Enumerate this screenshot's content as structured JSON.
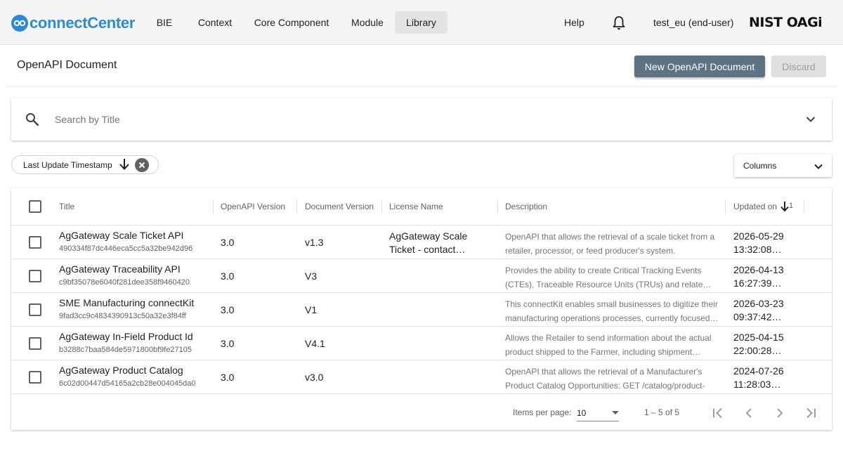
{
  "app": {
    "logo_text": "connectCenter",
    "nav": [
      "BIE",
      "Context",
      "Core Component",
      "Module",
      "Library"
    ],
    "help": "Help",
    "user": "test_eu (end-user)",
    "brand": "NIST OAGi"
  },
  "header": {
    "title": "OpenAPI Document",
    "new_button": "New OpenAPI Document",
    "discard_button": "Discard"
  },
  "search": {
    "placeholder": "Search by Title"
  },
  "sort_chip": {
    "label": "Last Update Timestamp"
  },
  "columns_button": "Columns",
  "table": {
    "headers": {
      "title": "Title",
      "openapi_version": "OpenAPI Version",
      "document_version": "Document Version",
      "license_name": "License Name",
      "description": "Description",
      "updated_on": "Updated on",
      "sort_index": "1"
    },
    "rows": [
      {
        "title": "AgGateway Scale Ticket API",
        "guid": "490334f87dc446eca5cc5a32be942d96",
        "openapi_version": "3.0",
        "document_version": "v1.3",
        "license_name": "AgGateway Scale Ticket - contact…",
        "description": "OpenAPI that allows the retrieval of a scale ticket from a retailer, processor, or feed producer's system.",
        "date": "2026-05-29",
        "time": "13:32:08…"
      },
      {
        "title": "AgGateway Traceability API",
        "guid": "c9bf35078e6040f281dee358f9460420",
        "openapi_version": "3.0",
        "document_version": "V3",
        "license_name": "",
        "description": "Provides the ability to create Critical Tracking Events (CTEs), Traceable Resource Units (TRUs) and relate…",
        "date": "2026-04-13",
        "time": "16:27:39…"
      },
      {
        "title": "SME Manufacturing connectKit",
        "guid": "9fad3cc9c4834390913c50a32e3f84ff",
        "openapi_version": "3.0",
        "document_version": "V1",
        "license_name": "",
        "description": "This connectKit enables small businesses to digitize their manufacturing operations processes, currently focused…",
        "date": "2026-03-23",
        "time": "09:37:42…"
      },
      {
        "title": "AgGateway In-Field Product Id",
        "guid": "b3288c7baa584de5971800bf9fe27105",
        "openapi_version": "3.0",
        "document_version": "V4.1",
        "license_name": "",
        "description": "Allows the Retailer to send information about the actual product shipped to the Farmer, including shipment…",
        "date": "2025-04-15",
        "time": "22:00:28…"
      },
      {
        "title": "AgGateway Product Catalog",
        "guid": "6c02d00447d54165a2cb28e004045da0",
        "openapi_version": "3.0",
        "document_version": "v3.0",
        "license_name": "",
        "description": "OpenAPI that allows the retrieval of a Manufacturer's Product Catalog Opportunities: GET /catalog/product-lis…",
        "date": "2024-07-26",
        "time": "11:28:03…"
      }
    ]
  },
  "paginator": {
    "items_per_page_label": "Items per page:",
    "items_per_page": "10",
    "range": "1 – 5 of 5"
  },
  "colors": {
    "brand_blue": "#2b8bd6",
    "primary_button": "#5b7384",
    "active_nav": "#e4e4e4"
  },
  "icons": [
    "bell-icon",
    "search-icon",
    "chevron-down-icon",
    "arrow-down-icon",
    "close-icon",
    "first-page-icon",
    "prev-page-icon",
    "next-page-icon",
    "last-page-icon"
  ]
}
